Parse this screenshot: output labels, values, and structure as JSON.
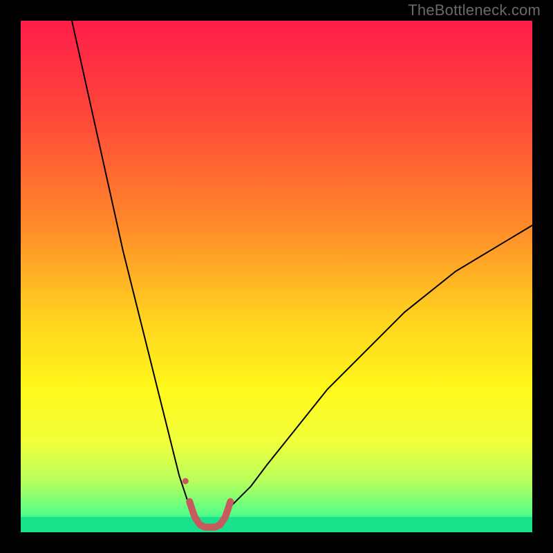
{
  "watermark": "TheBottleneck.com",
  "chart_data": {
    "type": "line",
    "title": "",
    "xlabel": "",
    "ylabel": "",
    "xlim": [
      0,
      100
    ],
    "ylim": [
      0,
      100
    ],
    "grid": false,
    "legend": false,
    "gradient_stops": [
      {
        "offset": 0.0,
        "color": "#ff1d4a"
      },
      {
        "offset": 0.2,
        "color": "#ff4b37"
      },
      {
        "offset": 0.4,
        "color": "#ff8a2a"
      },
      {
        "offset": 0.58,
        "color": "#ffd21f"
      },
      {
        "offset": 0.72,
        "color": "#fff81a"
      },
      {
        "offset": 0.82,
        "color": "#f2ff3a"
      },
      {
        "offset": 0.9,
        "color": "#b8ff5c"
      },
      {
        "offset": 0.96,
        "color": "#5cff84"
      },
      {
        "offset": 1.0,
        "color": "#19e28c"
      }
    ],
    "series": [
      {
        "name": "left-branch",
        "color": "#000000",
        "width": 2.0,
        "x": [
          10,
          12,
          14,
          16,
          18,
          20,
          22,
          24,
          25,
          26,
          27,
          28,
          29,
          30,
          31,
          32,
          33,
          34
        ],
        "y": [
          100,
          91,
          82,
          73,
          64,
          55,
          47,
          39,
          35,
          31,
          27,
          23,
          19,
          15,
          11,
          8,
          5,
          3
        ]
      },
      {
        "name": "right-branch",
        "color": "#000000",
        "width": 2.0,
        "x": [
          40,
          42,
          45,
          48,
          52,
          56,
          60,
          65,
          70,
          75,
          80,
          85,
          90,
          95,
          100
        ],
        "y": [
          4,
          6,
          9,
          13,
          18,
          23,
          28,
          33,
          38,
          43,
          47,
          51,
          54,
          57,
          60
        ]
      },
      {
        "name": "valley-highlight",
        "color": "#c75a5f",
        "width": 10,
        "x": [
          33,
          34,
          35,
          36,
          37,
          38,
          39,
          40,
          41
        ],
        "y": [
          6,
          3,
          1.5,
          1,
          1,
          1,
          1.5,
          3,
          6
        ]
      }
    ],
    "markers": [
      {
        "name": "left-dot",
        "x": 32.2,
        "y": 10,
        "r": 4.5,
        "color": "#c75a5f"
      }
    ],
    "green_band": {
      "y0": 0,
      "y1": 3
    }
  }
}
